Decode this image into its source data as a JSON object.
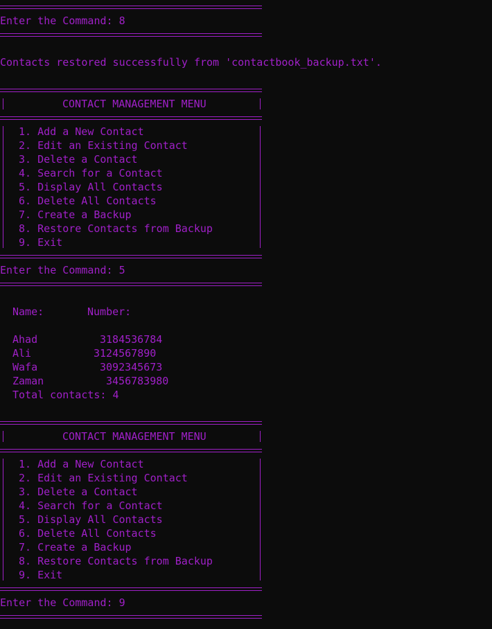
{
  "session": [
    {
      "name": "separator"
    },
    {
      "name": "prompt-line",
      "text": "Enter the Command: 8"
    },
    {
      "name": "separator"
    },
    {
      "name": "blank-line"
    },
    {
      "name": "restore-message",
      "text": "Contacts restored successfully from 'contactbook_backup.txt'."
    },
    {
      "name": "blank-line"
    },
    {
      "name": "menu"
    },
    {
      "name": "prompt-line",
      "text": "Enter the Command: 5"
    },
    {
      "name": "separator"
    },
    {
      "name": "blank-line"
    },
    {
      "name": "contacts-table"
    },
    {
      "name": "blank-line"
    },
    {
      "name": "menu"
    },
    {
      "name": "prompt-line",
      "text": "Enter the Command: 9"
    },
    {
      "name": "separator"
    }
  ],
  "menu": {
    "title": "CONTACT MANAGEMENT MENU",
    "items": [
      "1. Add a New Contact",
      "2. Edit an Existing Contact",
      "3. Delete a Contact",
      "4. Search for a Contact",
      "5. Display All Contacts",
      "6. Delete All Contacts",
      "7. Create a Backup",
      "8. Restore Contacts from Backup",
      "9. Exit"
    ]
  },
  "contacts": {
    "name_header": "Name:",
    "number_header": "Number:",
    "rows": [
      {
        "name": "Ahad",
        "number": "3184536784"
      },
      {
        "name": "Ali",
        "number": "3124567890"
      },
      {
        "name": "Wafa",
        "number": "3092345673"
      },
      {
        "name": "Zaman",
        "number": "3456783980"
      }
    ],
    "total": "Total contacts: 4"
  },
  "colors": {
    "background": "#0c0c0c",
    "text": "#a020c8"
  }
}
